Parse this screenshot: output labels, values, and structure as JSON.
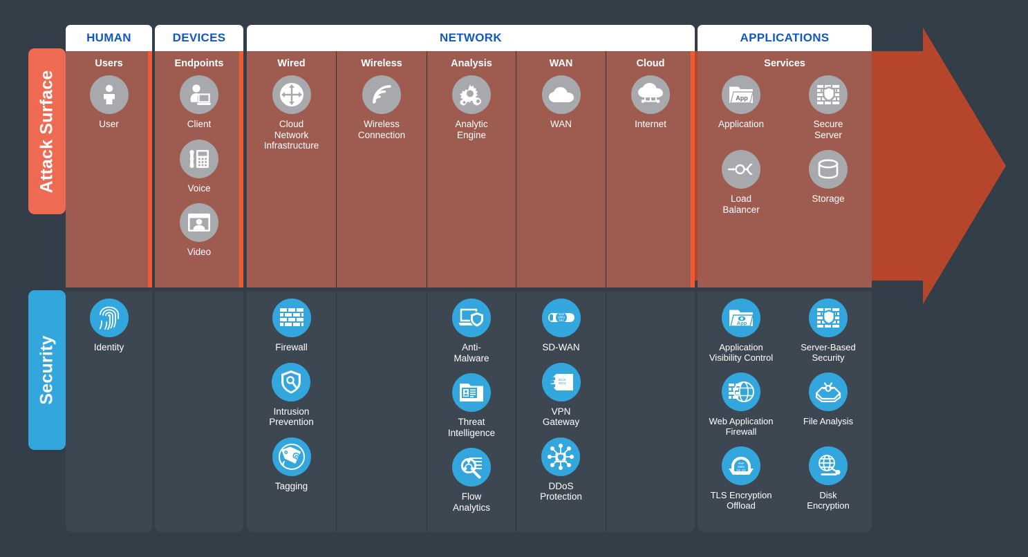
{
  "rows": {
    "attack_surface_label": "Attack Surface",
    "security_label": "Security"
  },
  "groups": [
    {
      "id": "human",
      "label": "HUMAN"
    },
    {
      "id": "devices",
      "label": "DEVICES"
    },
    {
      "id": "network",
      "label": "NETWORK"
    },
    {
      "id": "applications",
      "label": "APPLICATIONS"
    }
  ],
  "columns": [
    {
      "id": "users",
      "head": "Users"
    },
    {
      "id": "endpoints",
      "head": "Endpoints"
    },
    {
      "id": "wired",
      "head": "Wired"
    },
    {
      "id": "wireless",
      "head": "Wireless"
    },
    {
      "id": "analysis",
      "head": "Analysis"
    },
    {
      "id": "wan",
      "head": "WAN"
    },
    {
      "id": "cloud",
      "head": "Cloud"
    },
    {
      "id": "services",
      "head": "Services"
    }
  ],
  "attack_surface": {
    "users": [
      {
        "icon": "user-icon",
        "label": "User"
      }
    ],
    "endpoints": [
      {
        "icon": "client-laptop-icon",
        "label": "Client"
      },
      {
        "icon": "voice-phone-icon",
        "label": "Voice"
      },
      {
        "icon": "video-screen-icon",
        "label": "Video"
      }
    ],
    "wired": [
      {
        "icon": "router-icon",
        "label": "Cloud\nNetwork\nInfrastructure"
      }
    ],
    "wireless": [
      {
        "icon": "wifi-icon",
        "label": "Wireless\nConnection"
      }
    ],
    "analysis": [
      {
        "icon": "gears-icon",
        "label": "Analytic\nEngine"
      }
    ],
    "wan": [
      {
        "icon": "cloud-icon",
        "label": "WAN"
      }
    ],
    "cloud": [
      {
        "icon": "internet-cloud-icon",
        "label": "Internet"
      }
    ],
    "services": [
      {
        "icon": "app-folder-icon",
        "label": "Application"
      },
      {
        "icon": "secure-server-icon",
        "label": "Secure\nServer"
      },
      {
        "icon": "load-balancer-icon",
        "label": "Load\nBalancer"
      },
      {
        "icon": "storage-db-icon",
        "label": "Storage"
      }
    ]
  },
  "security": {
    "users": [
      {
        "icon": "fingerprint-icon",
        "label": "Identity"
      }
    ],
    "endpoints": [],
    "wired": [
      {
        "icon": "firewall-brick-icon",
        "label": "Firewall"
      },
      {
        "icon": "shield-search-icon",
        "label": "Intrusion\nPrevention"
      },
      {
        "icon": "tag-fingerprint-icon",
        "label": "Tagging"
      }
    ],
    "wireless": [],
    "analysis": [
      {
        "icon": "laptop-shield-icon",
        "label": "Anti-\nMalware"
      },
      {
        "icon": "threat-folder-icon",
        "label": "Threat\nIntelligence"
      },
      {
        "icon": "flow-magnifier-icon",
        "label": "Flow\nAnalytics"
      }
    ],
    "wan": [
      {
        "icon": "sdwan-link-icon",
        "label": "SD-WAN"
      },
      {
        "icon": "vpn-gateway-icon",
        "label": "VPN\nGateway"
      },
      {
        "icon": "ddos-nodes-icon",
        "label": "DDoS\nProtection"
      }
    ],
    "cloud": [],
    "services": [
      {
        "icon": "app-visibility-icon",
        "label": "Application\nVisibility Control"
      },
      {
        "icon": "server-security-icon",
        "label": "Server-Based\nSecurity"
      },
      {
        "icon": "web-app-firewall-icon",
        "label": "Web Application\nFirewall"
      },
      {
        "icon": "file-analysis-icon",
        "label": "File Analysis"
      },
      {
        "icon": "tls-offload-icon",
        "label": "TLS Encryption\nOffload"
      },
      {
        "icon": "disk-encryption-icon",
        "label": "Disk\nEncryption"
      }
    ]
  },
  "colors": {
    "background": "#343e48",
    "attack_band": "#9e5b50",
    "security_band": "#3c4752",
    "accent_red": "#ee5b33",
    "accent_blue": "#33a7dd",
    "tab_text": "#1358bf",
    "grey_badge": "#a7a9ac",
    "arrow": "#b5462b"
  }
}
